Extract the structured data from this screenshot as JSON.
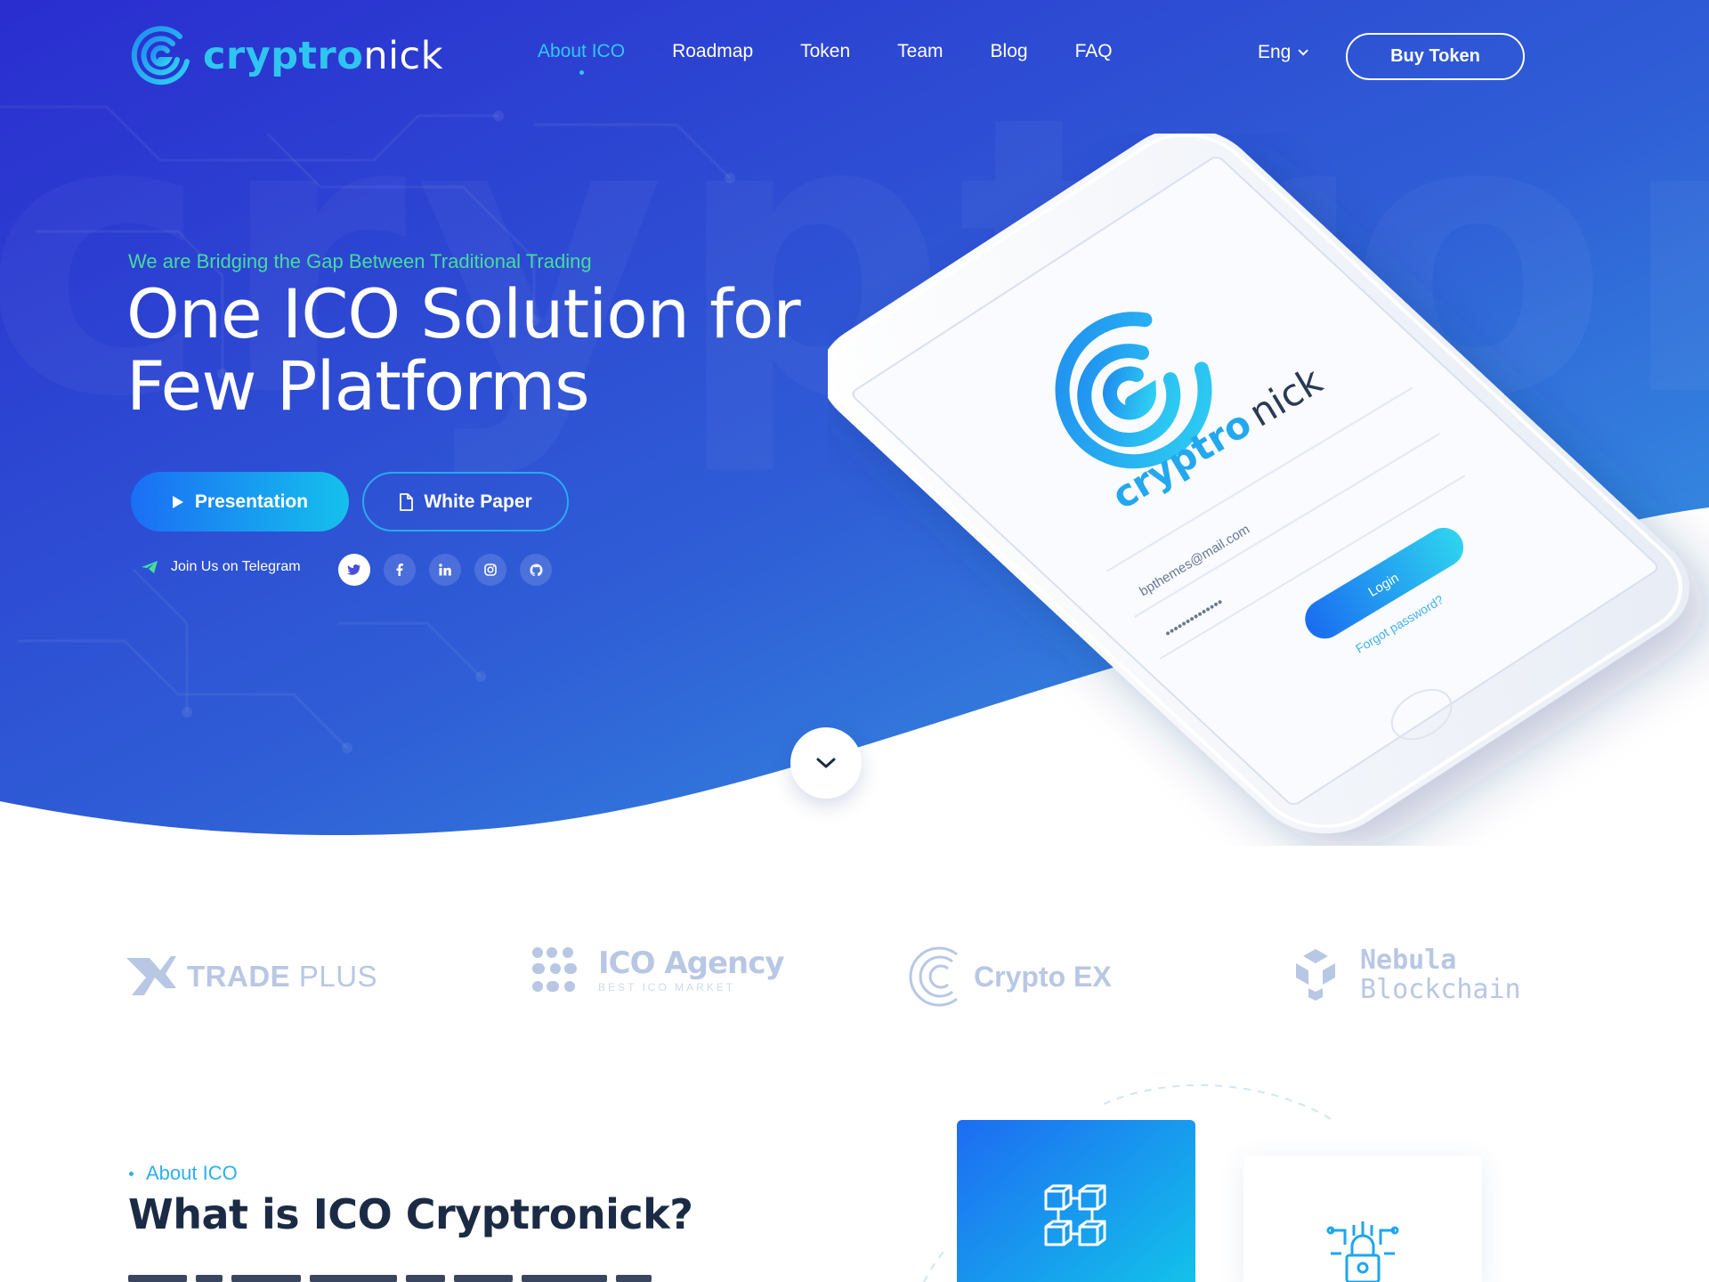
{
  "brand": {
    "name_bold": "cryptro",
    "name_light": "nick",
    "accent": "#32c7f2",
    "gradient_start": "#2b2fd0",
    "gradient_end": "#2e8fe0"
  },
  "nav": {
    "items": [
      "About ICO",
      "Roadmap",
      "Token",
      "Team",
      "Blog",
      "FAQ"
    ],
    "active": "About ICO",
    "language": "Eng",
    "buy_label": "Buy Token"
  },
  "hero": {
    "eyebrow": "We are Bridging the Gap Between Traditional Trading",
    "title_line1": "One ICO Solution for",
    "title_line2": "Few Platforms",
    "presentation_label": "Presentation",
    "whitepaper_label": "White Paper",
    "telegram_label": "Join Us on Telegram",
    "socials": [
      "twitter-icon",
      "facebook-icon",
      "linkedin-icon",
      "instagram-icon",
      "github-icon"
    ]
  },
  "phone": {
    "brand_bold": "cryptro",
    "brand_light": "nick",
    "email": "bpthemes@mail.com",
    "password": "••••••••••••••",
    "login_label": "Login",
    "forgot_label": "Forgot password?"
  },
  "partners": {
    "trade_plus": {
      "bold": "TRADE",
      "light": "PLUS"
    },
    "ico_agency": {
      "name": "ICO Agency",
      "tagline": "BEST ICO MARKET"
    },
    "crypto_ex": {
      "name": "Crypto EX"
    },
    "nebula": {
      "line1": "Nebula",
      "line2": "Blockchain"
    }
  },
  "about": {
    "tag": "About ICO",
    "title": "What is ICO Cryptronick?"
  }
}
